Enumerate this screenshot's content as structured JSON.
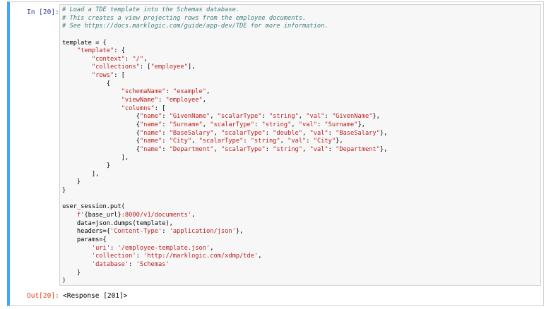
{
  "cell": {
    "in_prompt": "In [20]:",
    "out_prompt": "Out[20]:",
    "output": "<Response [201]>",
    "code_lines": [
      [
        {
          "t": "c",
          "v": "# Load a TDE template into the Schemas database."
        }
      ],
      [
        {
          "t": "c",
          "v": "# This creates a view projecting rows from the employee documents."
        }
      ],
      [
        {
          "t": "c",
          "v": "# See https://docs.marklogic.com/guide/app-dev/TDE for more information."
        }
      ],
      [],
      [
        {
          "t": "n",
          "v": "template = {"
        }
      ],
      [
        {
          "t": "n",
          "v": "    "
        },
        {
          "t": "s",
          "v": "\"template\""
        },
        {
          "t": "n",
          "v": ": {"
        }
      ],
      [
        {
          "t": "n",
          "v": "        "
        },
        {
          "t": "s",
          "v": "\"context\""
        },
        {
          "t": "n",
          "v": ": "
        },
        {
          "t": "s",
          "v": "\"/\""
        },
        {
          "t": "n",
          "v": ","
        }
      ],
      [
        {
          "t": "n",
          "v": "        "
        },
        {
          "t": "s",
          "v": "\"collections\""
        },
        {
          "t": "n",
          "v": ": ["
        },
        {
          "t": "s",
          "v": "\"employee\""
        },
        {
          "t": "n",
          "v": "],"
        }
      ],
      [
        {
          "t": "n",
          "v": "        "
        },
        {
          "t": "s",
          "v": "\"rows\""
        },
        {
          "t": "n",
          "v": ": ["
        }
      ],
      [
        {
          "t": "n",
          "v": "            {"
        }
      ],
      [
        {
          "t": "n",
          "v": "                "
        },
        {
          "t": "s",
          "v": "\"schemaName\""
        },
        {
          "t": "n",
          "v": ": "
        },
        {
          "t": "s",
          "v": "\"example\""
        },
        {
          "t": "n",
          "v": ","
        }
      ],
      [
        {
          "t": "n",
          "v": "                "
        },
        {
          "t": "s",
          "v": "\"viewName\""
        },
        {
          "t": "n",
          "v": ": "
        },
        {
          "t": "s",
          "v": "\"employee\""
        },
        {
          "t": "n",
          "v": ","
        }
      ],
      [
        {
          "t": "n",
          "v": "                "
        },
        {
          "t": "s",
          "v": "\"columns\""
        },
        {
          "t": "n",
          "v": ": ["
        }
      ],
      [
        {
          "t": "n",
          "v": "                    {"
        },
        {
          "t": "s",
          "v": "\"name\""
        },
        {
          "t": "n",
          "v": ": "
        },
        {
          "t": "s",
          "v": "\"GivenName\""
        },
        {
          "t": "n",
          "v": ", "
        },
        {
          "t": "s",
          "v": "\"scalarType\""
        },
        {
          "t": "n",
          "v": ": "
        },
        {
          "t": "s",
          "v": "\"string\""
        },
        {
          "t": "n",
          "v": ", "
        },
        {
          "t": "s",
          "v": "\"val\""
        },
        {
          "t": "n",
          "v": ": "
        },
        {
          "t": "s",
          "v": "\"GivenName\""
        },
        {
          "t": "n",
          "v": "},"
        }
      ],
      [
        {
          "t": "n",
          "v": "                    {"
        },
        {
          "t": "s",
          "v": "\"name\""
        },
        {
          "t": "n",
          "v": ": "
        },
        {
          "t": "s",
          "v": "\"Surname\""
        },
        {
          "t": "n",
          "v": ", "
        },
        {
          "t": "s",
          "v": "\"scalarType\""
        },
        {
          "t": "n",
          "v": ": "
        },
        {
          "t": "s",
          "v": "\"string\""
        },
        {
          "t": "n",
          "v": ", "
        },
        {
          "t": "s",
          "v": "\"val\""
        },
        {
          "t": "n",
          "v": ": "
        },
        {
          "t": "s",
          "v": "\"Surname\""
        },
        {
          "t": "n",
          "v": "},"
        }
      ],
      [
        {
          "t": "n",
          "v": "                    {"
        },
        {
          "t": "s",
          "v": "\"name\""
        },
        {
          "t": "n",
          "v": ": "
        },
        {
          "t": "s",
          "v": "\"BaseSalary\""
        },
        {
          "t": "n",
          "v": ", "
        },
        {
          "t": "s",
          "v": "\"scalarType\""
        },
        {
          "t": "n",
          "v": ": "
        },
        {
          "t": "s",
          "v": "\"double\""
        },
        {
          "t": "n",
          "v": ", "
        },
        {
          "t": "s",
          "v": "\"val\""
        },
        {
          "t": "n",
          "v": ": "
        },
        {
          "t": "s",
          "v": "\"BaseSalary\""
        },
        {
          "t": "n",
          "v": "},"
        }
      ],
      [
        {
          "t": "n",
          "v": "                    {"
        },
        {
          "t": "s",
          "v": "\"name\""
        },
        {
          "t": "n",
          "v": ": "
        },
        {
          "t": "s",
          "v": "\"City\""
        },
        {
          "t": "n",
          "v": ", "
        },
        {
          "t": "s",
          "v": "\"scalarType\""
        },
        {
          "t": "n",
          "v": ": "
        },
        {
          "t": "s",
          "v": "\"string\""
        },
        {
          "t": "n",
          "v": ", "
        },
        {
          "t": "s",
          "v": "\"val\""
        },
        {
          "t": "n",
          "v": ": "
        },
        {
          "t": "s",
          "v": "\"City\""
        },
        {
          "t": "n",
          "v": "},"
        }
      ],
      [
        {
          "t": "n",
          "v": "                    {"
        },
        {
          "t": "s",
          "v": "\"name\""
        },
        {
          "t": "n",
          "v": ": "
        },
        {
          "t": "s",
          "v": "\"Department\""
        },
        {
          "t": "n",
          "v": ", "
        },
        {
          "t": "s",
          "v": "\"scalarType\""
        },
        {
          "t": "n",
          "v": ": "
        },
        {
          "t": "s",
          "v": "\"string\""
        },
        {
          "t": "n",
          "v": ", "
        },
        {
          "t": "s",
          "v": "\"val\""
        },
        {
          "t": "n",
          "v": ": "
        },
        {
          "t": "s",
          "v": "\"Department\""
        },
        {
          "t": "n",
          "v": "},"
        }
      ],
      [
        {
          "t": "n",
          "v": "                ],"
        }
      ],
      [
        {
          "t": "n",
          "v": "            }"
        }
      ],
      [
        {
          "t": "n",
          "v": "        ],"
        }
      ],
      [
        {
          "t": "n",
          "v": "    }"
        }
      ],
      [
        {
          "t": "n",
          "v": "}"
        }
      ],
      [],
      [
        {
          "t": "n",
          "v": "user_session.put("
        }
      ],
      [
        {
          "t": "n",
          "v": "    "
        },
        {
          "t": "s",
          "v": "f'"
        },
        {
          "t": "n",
          "v": "{base_url}"
        },
        {
          "t": "s",
          "v": ":8000/v1/documents'"
        },
        {
          "t": "n",
          "v": ","
        }
      ],
      [
        {
          "t": "n",
          "v": "    data=json.dumps(template),"
        }
      ],
      [
        {
          "t": "n",
          "v": "    headers={"
        },
        {
          "t": "s",
          "v": "'Content-Type'"
        },
        {
          "t": "n",
          "v": ": "
        },
        {
          "t": "s",
          "v": "'application/json'"
        },
        {
          "t": "n",
          "v": "},"
        }
      ],
      [
        {
          "t": "n",
          "v": "    params={"
        }
      ],
      [
        {
          "t": "n",
          "v": "        "
        },
        {
          "t": "s",
          "v": "'uri'"
        },
        {
          "t": "n",
          "v": ": "
        },
        {
          "t": "s",
          "v": "'/employee-template.json'"
        },
        {
          "t": "n",
          "v": ","
        }
      ],
      [
        {
          "t": "n",
          "v": "        "
        },
        {
          "t": "s",
          "v": "'collection'"
        },
        {
          "t": "n",
          "v": ": "
        },
        {
          "t": "s",
          "v": "'http://marklogic.com/xdmp/tde'"
        },
        {
          "t": "n",
          "v": ","
        }
      ],
      [
        {
          "t": "n",
          "v": "        "
        },
        {
          "t": "s",
          "v": "'database'"
        },
        {
          "t": "n",
          "v": ": "
        },
        {
          "t": "s",
          "v": "'Schemas'"
        }
      ],
      [
        {
          "t": "n",
          "v": "    }"
        }
      ],
      [
        {
          "t": "n",
          "v": ")"
        }
      ]
    ]
  },
  "colors": {
    "cell_border": "#cfcfcf",
    "selected_bar": "#42a5f5",
    "in_prompt": "#303f9f",
    "out_prompt": "#d84315",
    "comment": "#408080",
    "string": "#ba2121"
  }
}
